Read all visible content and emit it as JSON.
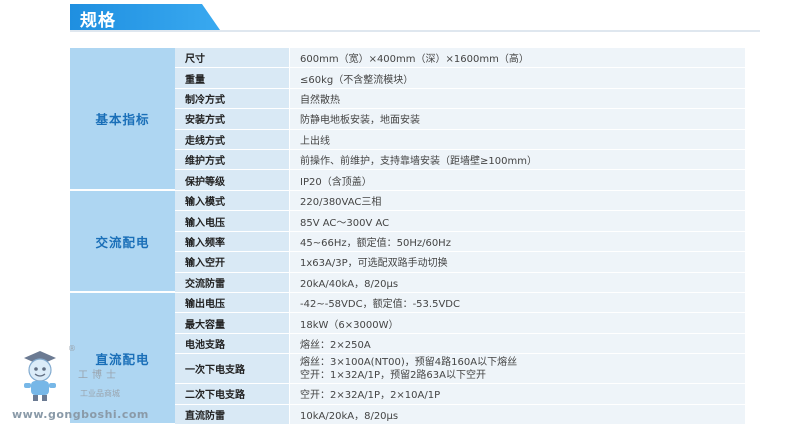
{
  "title": "规格",
  "groups": [
    {
      "label": "基本指标",
      "rows": [
        {
          "key": "尺寸",
          "value": "600mm（宽）×400mm（深）×1600mm（高）"
        },
        {
          "key": "重量",
          "value": "≤60kg（不含整流模块）"
        },
        {
          "key": "制冷方式",
          "value": "自然散热"
        },
        {
          "key": "安装方式",
          "value": "防静电地板安装，地面安装"
        },
        {
          "key": "走线方式",
          "value": "上出线"
        },
        {
          "key": "维护方式",
          "value": "前操作、前维护，支持靠墙安装（距墙壁≥100mm）"
        },
        {
          "key": "保护等级",
          "value": "IP20（含顶盖）"
        }
      ]
    },
    {
      "label": "交流配电",
      "rows": [
        {
          "key": "输入模式",
          "value": "220/380VAC三相"
        },
        {
          "key": "输入电压",
          "value": "85V AC～300V AC"
        },
        {
          "key": "输入频率",
          "value": "45~66Hz，额定值：50Hz/60Hz"
        },
        {
          "key": "输入空开",
          "value": "1x63A/3P，可选配双路手动切换"
        },
        {
          "key": "交流防雷",
          "value": "20kA/40kA，8/20μs"
        }
      ]
    },
    {
      "label": "直流配电",
      "rows": [
        {
          "key": "输出电压",
          "value": "-42~-58VDC，额定值：-53.5VDC"
        },
        {
          "key": "最大容量",
          "value": "18kW（6×3000W）"
        },
        {
          "key": "电池支路",
          "value": "熔丝：2×250A"
        },
        {
          "key": "一次下电支路",
          "value": "熔丝：3×100A(NT00)，预留4路160A以下熔丝",
          "value2": "空开：1×32A/1P，预留2路63A以下空开"
        },
        {
          "key": "二次下电支路",
          "value": "空开：2×32A/1P，2×10A/1P"
        },
        {
          "key": "直流防雷",
          "value": "10kA/20kA，8/20μs"
        }
      ]
    }
  ],
  "watermark": {
    "brand": "工博士",
    "sub": "工业品商城",
    "url": "www.gongboshi.com",
    "reg": "®"
  },
  "colors": {
    "accent": "#1f8fe0",
    "group_bg": "#aed6f2",
    "key_bg": "#d9e9f5",
    "value_bg": "#eef4f9"
  }
}
